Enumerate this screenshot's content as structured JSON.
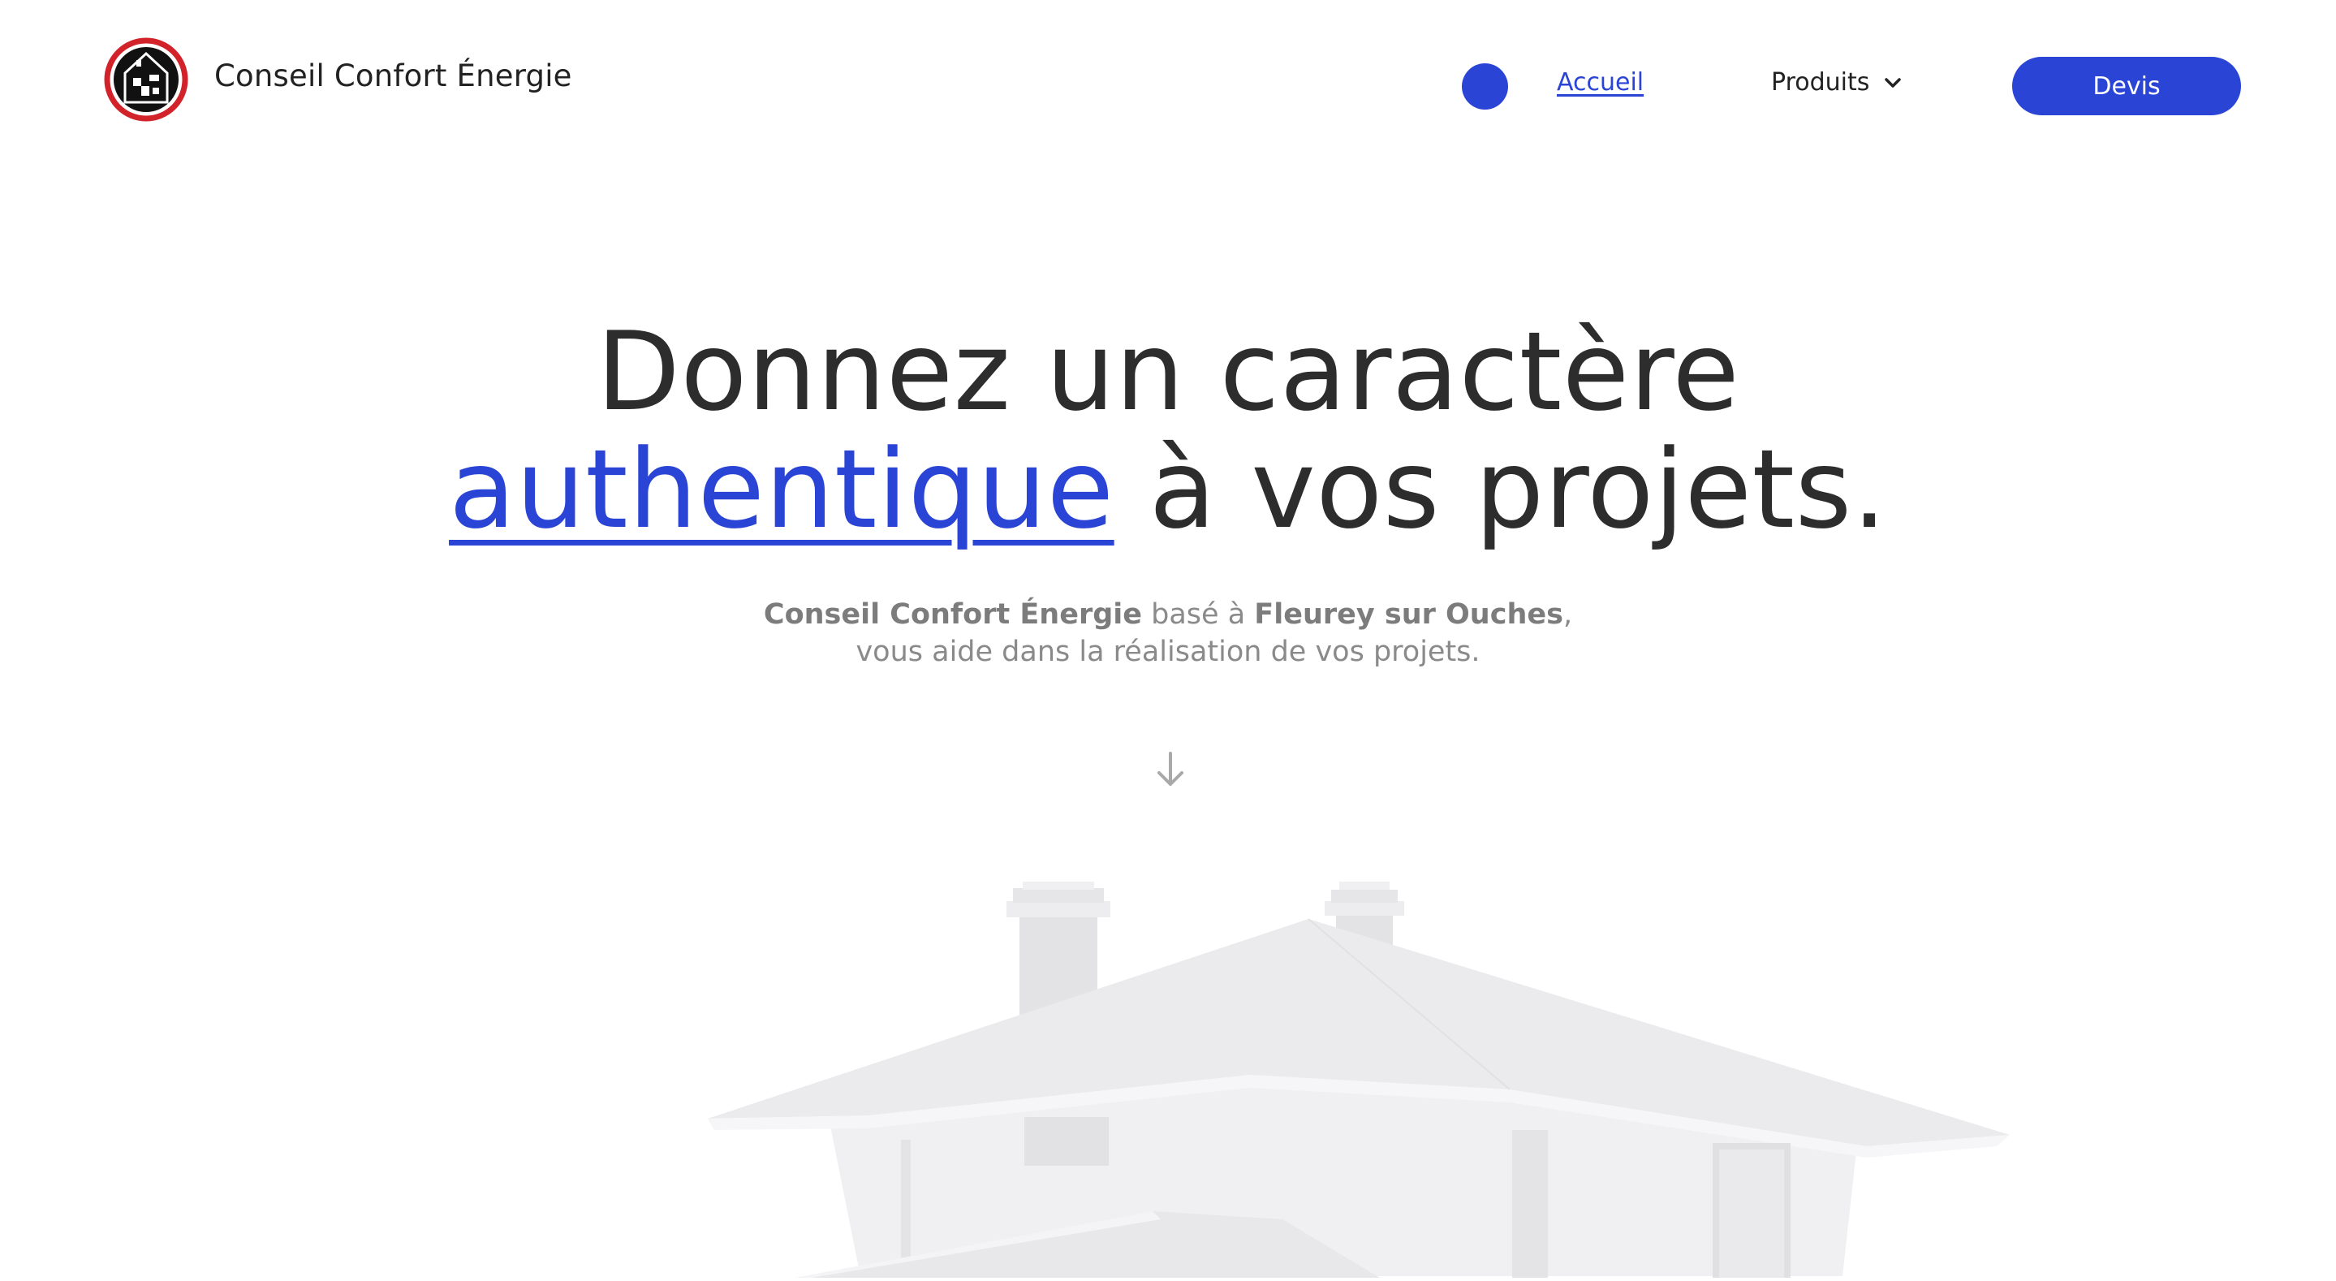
{
  "brand": {
    "name": "Conseil Confort Énergie",
    "logo_icon": "house-logo-icon"
  },
  "nav": {
    "home_label": "Accueil",
    "products_label": "Produits",
    "products_icon": "chevron-down-icon",
    "cta_label": "Devis"
  },
  "hero": {
    "title_line1": "Donnez un caractère",
    "title_accent": "authentique",
    "title_rest": "à vos projets.",
    "subtitle": {
      "company": "Conseil Confort Énergie",
      "text_based": "basé à",
      "location": "Fleurey sur Ouches",
      "text_rest": ", vous aide dans la réalisation de vos projets."
    },
    "scroll_icon": "arrow-down-icon"
  },
  "colors": {
    "accent": "#2a45d6",
    "logo_ring": "#d2232a",
    "text": "#2b2b2b",
    "muted": "#8a8a8a"
  }
}
